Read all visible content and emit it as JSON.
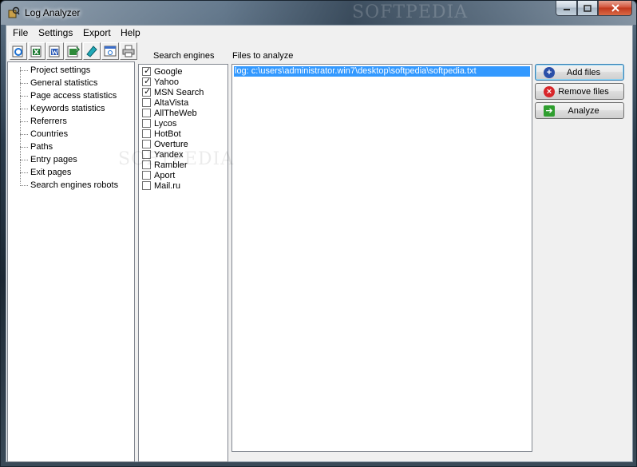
{
  "window": {
    "title": "Log Analyzer",
    "watermark": "SOFTPEDIA"
  },
  "menu": {
    "items": [
      "File",
      "Settings",
      "Export",
      "Help"
    ]
  },
  "toolbar": {
    "icons": [
      "export-ie-icon",
      "export-excel-icon",
      "export-word-icon",
      "export-excel-alt-icon",
      "export-note-icon",
      "export-html-icon",
      "print-icon"
    ]
  },
  "tree": {
    "items": [
      "Project settings",
      "General statistics",
      "Page access statistics",
      "Keywords statistics",
      "Referrers",
      "Countries",
      "Paths",
      "Entry pages",
      "Exit pages",
      "Search engines robots"
    ]
  },
  "search_engines": {
    "label": "Search engines",
    "items": [
      {
        "name": "Google",
        "checked": true
      },
      {
        "name": "Yahoo",
        "checked": true
      },
      {
        "name": "MSN Search",
        "checked": true
      },
      {
        "name": "AltaVista",
        "checked": false
      },
      {
        "name": "AllTheWeb",
        "checked": false
      },
      {
        "name": "Lycos",
        "checked": false
      },
      {
        "name": "HotBot",
        "checked": false
      },
      {
        "name": "Overture",
        "checked": false
      },
      {
        "name": "Yandex",
        "checked": false
      },
      {
        "name": "Rambler",
        "checked": false
      },
      {
        "name": "Aport",
        "checked": false
      },
      {
        "name": "Mail.ru",
        "checked": false
      }
    ]
  },
  "files": {
    "label": "Files to analyze",
    "items": [
      "log: c:\\users\\administrator.win7\\desktop\\softpedia\\softpedia.txt"
    ]
  },
  "buttons": {
    "add": "Add files",
    "remove": "Remove files",
    "analyze": "Analyze"
  },
  "colors": {
    "selection": "#3399ff",
    "add_icon": "#2a4fa8",
    "remove_icon": "#d8262a",
    "analyze_icon": "#2f9e2f"
  }
}
